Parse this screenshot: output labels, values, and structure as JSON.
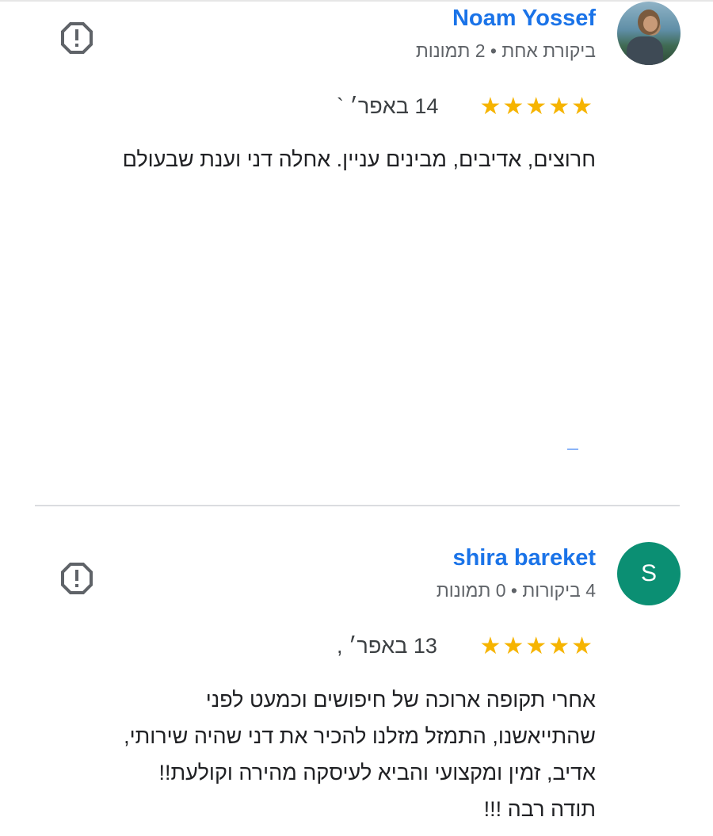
{
  "reviews": [
    {
      "name": "Noam Yossef",
      "meta": "ביקורת אחת • 2 תמונות",
      "stars": "★★★★★",
      "date": "14 באפר׳ `",
      "text": [
        "חרוצים, אדיבים, מבינים עניין. אחלה דני וענת שבעולם"
      ],
      "avatar_icon": "user-photo"
    },
    {
      "name": "shira bareket",
      "meta": "4 ביקורות • 0 תמונות",
      "stars": "★★★★★",
      "date": "13 באפר׳ ,",
      "text": [
        "אחרי תקופה ארוכה של חיפושים וכמעט לפני",
        "שהתייאשנו, התמזל מזלנו להכיר את דני שהיה שירותי,",
        "אדיב, זמין ומקצועי והביא לעיסקה מהירה וקולעת!!",
        "תודה רבה !!!"
      ],
      "avatar_letter": "S",
      "avatar_color": "#0b8f73"
    }
  ],
  "colors": {
    "name": "#1a73e8",
    "star": "#f6b400",
    "meta": "#5f6368"
  },
  "icons": {
    "report": "report-flag-octagon-icon"
  }
}
